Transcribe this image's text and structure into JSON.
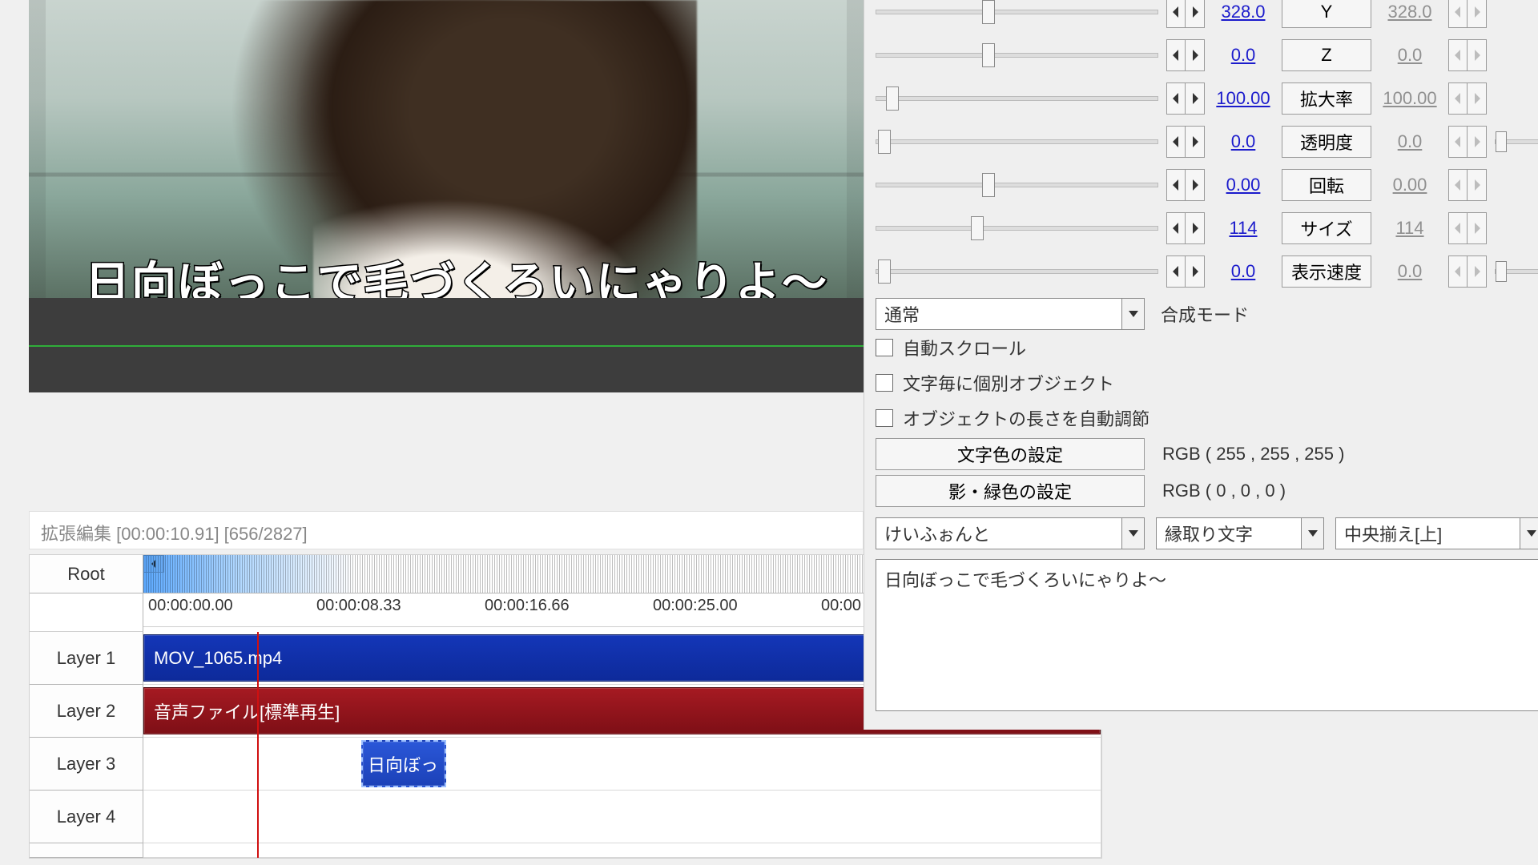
{
  "preview": {
    "subtitle": "日向ぼっこで毛づくろいにゃりよ〜"
  },
  "timeline": {
    "title": "拡張編集 [00:00:10.91] [656/2827]",
    "root_label": "Root",
    "ruler": [
      "00:00:00.00",
      "00:00:08.33",
      "00:00:16.66",
      "00:00:25.00",
      "00:00"
    ],
    "layers": [
      "Layer 1",
      "Layer 2",
      "Layer 3",
      "Layer 4"
    ],
    "clips": {
      "video": "MOV_1065.mp4",
      "audio": "音声ファイル[標準再生]",
      "text": "日向ぼっ"
    }
  },
  "panel": {
    "props": [
      {
        "label": "Y",
        "v1": "328.0",
        "v2": "328.0",
        "thumb": 40,
        "t2disabled": true
      },
      {
        "label": "Z",
        "v1": "0.0",
        "v2": "0.0",
        "thumb": 40,
        "t2disabled": true
      },
      {
        "label": "拡大率",
        "v1": "100.00",
        "v2": "100.00",
        "thumb": 6,
        "t2disabled": true
      },
      {
        "label": "透明度",
        "v1": "0.0",
        "v2": "0.0",
        "thumb": 3,
        "t2disabled": true,
        "trail": true
      },
      {
        "label": "回転",
        "v1": "0.00",
        "v2": "0.00",
        "thumb": 40,
        "t2disabled": true
      },
      {
        "label": "サイズ",
        "v1": "114",
        "v2": "114",
        "thumb": 36,
        "t2disabled": true
      },
      {
        "label": "表示速度",
        "v1": "0.0",
        "v2": "0.0",
        "thumb": 3,
        "t2disabled": true,
        "trail": true
      }
    ],
    "blend_mode": {
      "value": "通常",
      "label": "合成モード"
    },
    "checks": [
      "自動スクロール",
      "文字毎に個別オブジェクト",
      "オブジェクトの長さを自動調節"
    ],
    "color_buttons": {
      "text": {
        "btn": "文字色の設定",
        "rgb": "RGB ( 255 , 255 , 255 )"
      },
      "shadow": {
        "btn": "影・緑色の設定",
        "rgb": "RGB ( 0 , 0 , 0 )"
      }
    },
    "selects": {
      "font": "けいふぉんと",
      "style": "縁取り文字",
      "align": "中央揃え[上]"
    },
    "text_value": "日向ぼっこで毛づくろいにゃりよ〜"
  }
}
